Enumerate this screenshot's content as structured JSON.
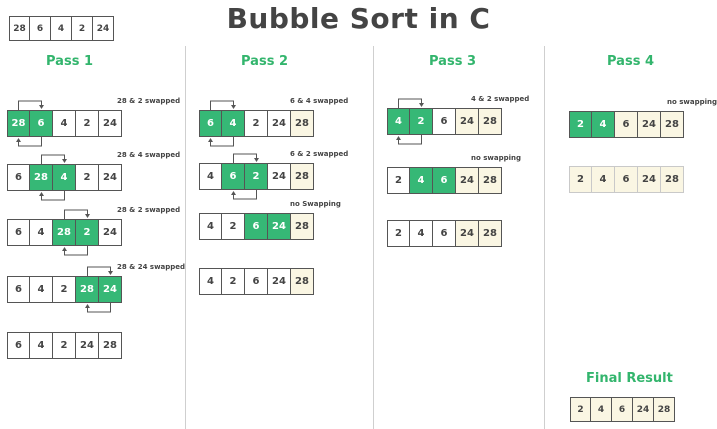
{
  "title": "Bubble Sort in C",
  "initial_array": [
    "28",
    "6",
    "4",
    "2",
    "24"
  ],
  "passes": [
    {
      "label": "Pass 1",
      "steps": [
        {
          "values": [
            "28",
            "6",
            "4",
            "2",
            "24"
          ],
          "highlight": [
            0,
            1
          ],
          "sorted": [],
          "note": "28 & 2 swapped"
        },
        {
          "values": [
            "6",
            "28",
            "4",
            "2",
            "24"
          ],
          "highlight": [
            1,
            2
          ],
          "sorted": [],
          "note": "28 & 4 swapped"
        },
        {
          "values": [
            "6",
            "4",
            "28",
            "2",
            "24"
          ],
          "highlight": [
            2,
            3
          ],
          "sorted": [],
          "note": "28 & 2 swapped"
        },
        {
          "values": [
            "6",
            "4",
            "2",
            "28",
            "24"
          ],
          "highlight": [
            3,
            4
          ],
          "sorted": [],
          "note": "28 & 24 swapped"
        },
        {
          "values": [
            "6",
            "4",
            "2",
            "24",
            "28"
          ],
          "highlight": [],
          "sorted": [],
          "note": ""
        }
      ]
    },
    {
      "label": "Pass 2",
      "steps": [
        {
          "values": [
            "6",
            "4",
            "2",
            "24",
            "28"
          ],
          "highlight": [
            0,
            1
          ],
          "sorted": [
            4
          ],
          "note": "6 & 4 swapped"
        },
        {
          "values": [
            "4",
            "6",
            "2",
            "24",
            "28"
          ],
          "highlight": [
            1,
            2
          ],
          "sorted": [
            4
          ],
          "note": "6 & 2 swapped"
        },
        {
          "values": [
            "4",
            "2",
            "6",
            "24",
            "28"
          ],
          "highlight": [
            2,
            3
          ],
          "sorted": [
            4
          ],
          "note": "no Swapping"
        },
        {
          "values": [
            "4",
            "2",
            "6",
            "24",
            "28"
          ],
          "highlight": [],
          "sorted": [
            4
          ],
          "note": ""
        }
      ]
    },
    {
      "label": "Pass 3",
      "steps": [
        {
          "values": [
            "4",
            "2",
            "6",
            "24",
            "28"
          ],
          "highlight": [
            0,
            1
          ],
          "sorted": [
            3,
            4
          ],
          "note": "4 & 2 swapped"
        },
        {
          "values": [
            "2",
            "4",
            "6",
            "24",
            "28"
          ],
          "highlight": [
            1,
            2
          ],
          "sorted": [
            3,
            4
          ],
          "note": "no swapping"
        },
        {
          "values": [
            "2",
            "4",
            "6",
            "24",
            "28"
          ],
          "highlight": [],
          "sorted": [
            3,
            4
          ],
          "note": ""
        }
      ]
    },
    {
      "label": "Pass 4",
      "steps": [
        {
          "values": [
            "2",
            "4",
            "6",
            "24",
            "28"
          ],
          "highlight": [
            0,
            1
          ],
          "sorted": [
            2,
            3,
            4
          ],
          "note": "no swapping"
        },
        {
          "values": [
            "2",
            "4",
            "6",
            "24",
            "28"
          ],
          "highlight": [],
          "sorted": [
            0,
            1,
            2,
            3,
            4
          ],
          "note": ""
        }
      ]
    }
  ],
  "final": {
    "label": "Final Result",
    "values": [
      "2",
      "4",
      "6",
      "24",
      "28"
    ]
  },
  "colors": {
    "accent": "#36b876",
    "heading": "#33b56d",
    "sorted": "#faf6e3",
    "text": "#444444"
  }
}
